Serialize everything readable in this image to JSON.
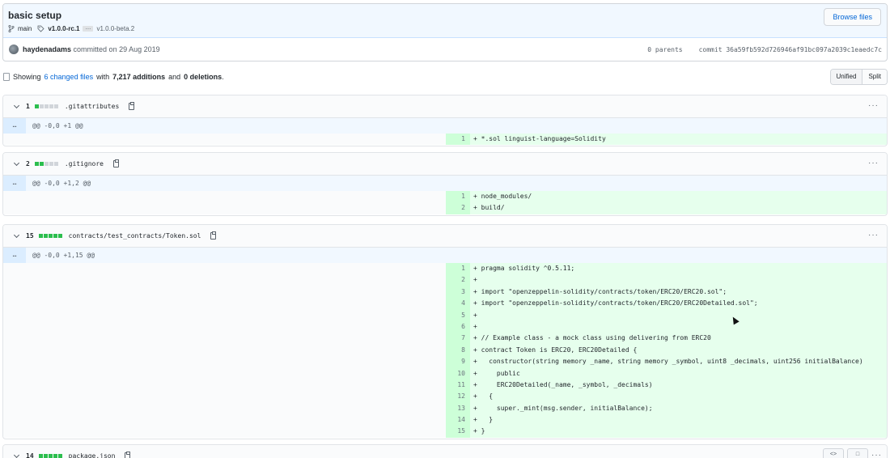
{
  "commit": {
    "title": "basic setup",
    "branch": "main",
    "tag_primary": "v1.0.0-rc.1",
    "tag_ellipsis": "…",
    "tag_secondary": "v1.0.0-beta.2",
    "browse_label": "Browse files",
    "author": "haydenadams",
    "committed_text": "committed on 29 Aug 2019",
    "parents_text": "0 parents",
    "commit_label": "commit",
    "sha": "36a59fb592d726946af91bc097a2039c1eaedc7c"
  },
  "summary": {
    "showing": "Showing",
    "changed_files": "6 changed files",
    "with": "with",
    "additions": "7,217 additions",
    "and": "and",
    "deletions": "0 deletions",
    "period": "."
  },
  "view_toggle": {
    "unified": "Unified",
    "split": "Split",
    "selected": "Unified"
  },
  "files": [
    {
      "count": "1",
      "path": ".gitattributes",
      "hunk": "@@ -0,0 +1 @@",
      "expand": "…",
      "lines": [
        {
          "num": "1",
          "code": "+ *.sol linguist-language=Solidity"
        }
      ]
    },
    {
      "count": "2",
      "path": ".gitignore",
      "hunk": "@@ -0,0 +1,2 @@",
      "expand": "…",
      "lines": [
        {
          "num": "1",
          "code": "+ node_modules/"
        },
        {
          "num": "2",
          "code": "+ build/"
        }
      ]
    },
    {
      "count": "15",
      "path": "contracts/test_contracts/Token.sol",
      "hunk": "@@ -0,0 +1,15 @@",
      "expand": "…",
      "lines": [
        {
          "num": "1",
          "code": "+ pragma solidity ^0.5.11;"
        },
        {
          "num": "2",
          "code": "+"
        },
        {
          "num": "3",
          "code": "+ import \"openzeppelin-solidity/contracts/token/ERC20/ERC20.sol\";"
        },
        {
          "num": "4",
          "code": "+ import \"openzeppelin-solidity/contracts/token/ERC20/ERC20Detailed.sol\";"
        },
        {
          "num": "5",
          "code": "+"
        },
        {
          "num": "6",
          "code": "+"
        },
        {
          "num": "7",
          "code": "+ // Example class - a mock class using delivering from ERC20"
        },
        {
          "num": "8",
          "code": "+ contract Token is ERC20, ERC20Detailed {"
        },
        {
          "num": "9",
          "code": "+   constructor(string memory _name, string memory _symbol, uint8 _decimals, uint256 initialBalance)"
        },
        {
          "num": "10",
          "code": "+     public"
        },
        {
          "num": "11",
          "code": "+     ERC20Detailed(_name, _symbol, _decimals)"
        },
        {
          "num": "12",
          "code": "+   {"
        },
        {
          "num": "13",
          "code": "+     super._mint(msg.sender, initialBalance);"
        },
        {
          "num": "14",
          "code": "+   }"
        },
        {
          "num": "15",
          "code": "+ }"
        }
      ]
    },
    {
      "count": "14",
      "path": "package.json"
    }
  ],
  "icons": {
    "branch": "git-branch-icon",
    "tag": "tag-icon",
    "copy": "clipboard-icon",
    "expand": "chevron-down-icon",
    "menu": "kebab-horizontal-icon",
    "file": "file-diff-icon"
  },
  "colors": {
    "link": "#0366d6",
    "addition_bg": "#e6ffed",
    "addition_num_bg": "#cdffd8",
    "diffstat_add": "#2cbe4e",
    "hunk_bg": "#f1f8ff"
  }
}
